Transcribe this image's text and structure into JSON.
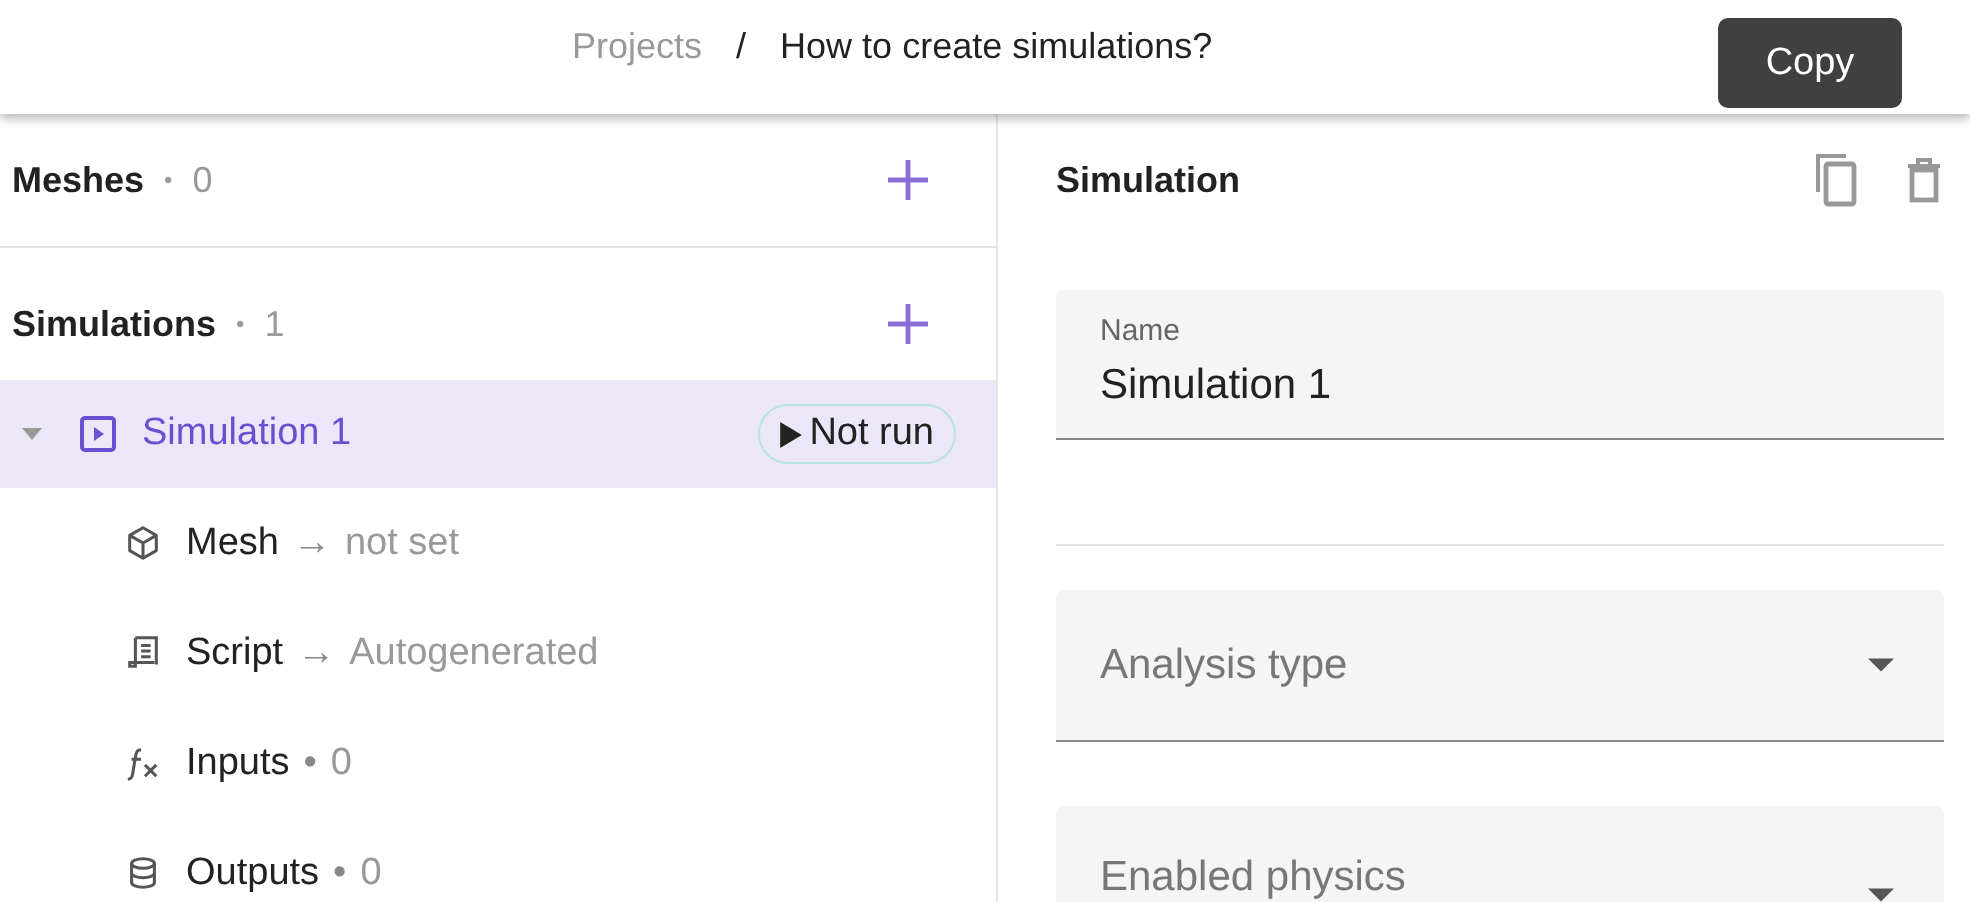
{
  "header": {
    "breadcrumbs": [
      {
        "label": "Projects",
        "current": false
      },
      {
        "label": "How to create simulations?",
        "current": true
      }
    ],
    "separator": "/",
    "tooltip": "Copy"
  },
  "sidebar": {
    "sections": [
      {
        "title": "Meshes",
        "separator": "•",
        "count": "0"
      },
      {
        "title": "Simulations",
        "separator": "•",
        "count": "1",
        "items": [
          {
            "label": "Simulation 1",
            "status": "Not run",
            "selected": true,
            "expanded": true,
            "children": [
              {
                "kind": "mesh",
                "label": "Mesh",
                "separator": "→",
                "value": "not set"
              },
              {
                "kind": "script",
                "label": "Script",
                "separator": "→",
                "value": "Autogenerated"
              },
              {
                "kind": "inputs",
                "label": "Inputs",
                "separator": "•",
                "value": "0"
              },
              {
                "kind": "outputs",
                "label": "Outputs",
                "separator": "•",
                "value": "0"
              }
            ]
          }
        ]
      }
    ]
  },
  "panel": {
    "title": "Simulation",
    "fields": [
      {
        "kind": "text",
        "label": "Name",
        "value": "Simulation 1"
      },
      {
        "kind": "select",
        "placeholder": "Analysis type"
      },
      {
        "kind": "select",
        "placeholder": "Enabled physics"
      }
    ]
  }
}
